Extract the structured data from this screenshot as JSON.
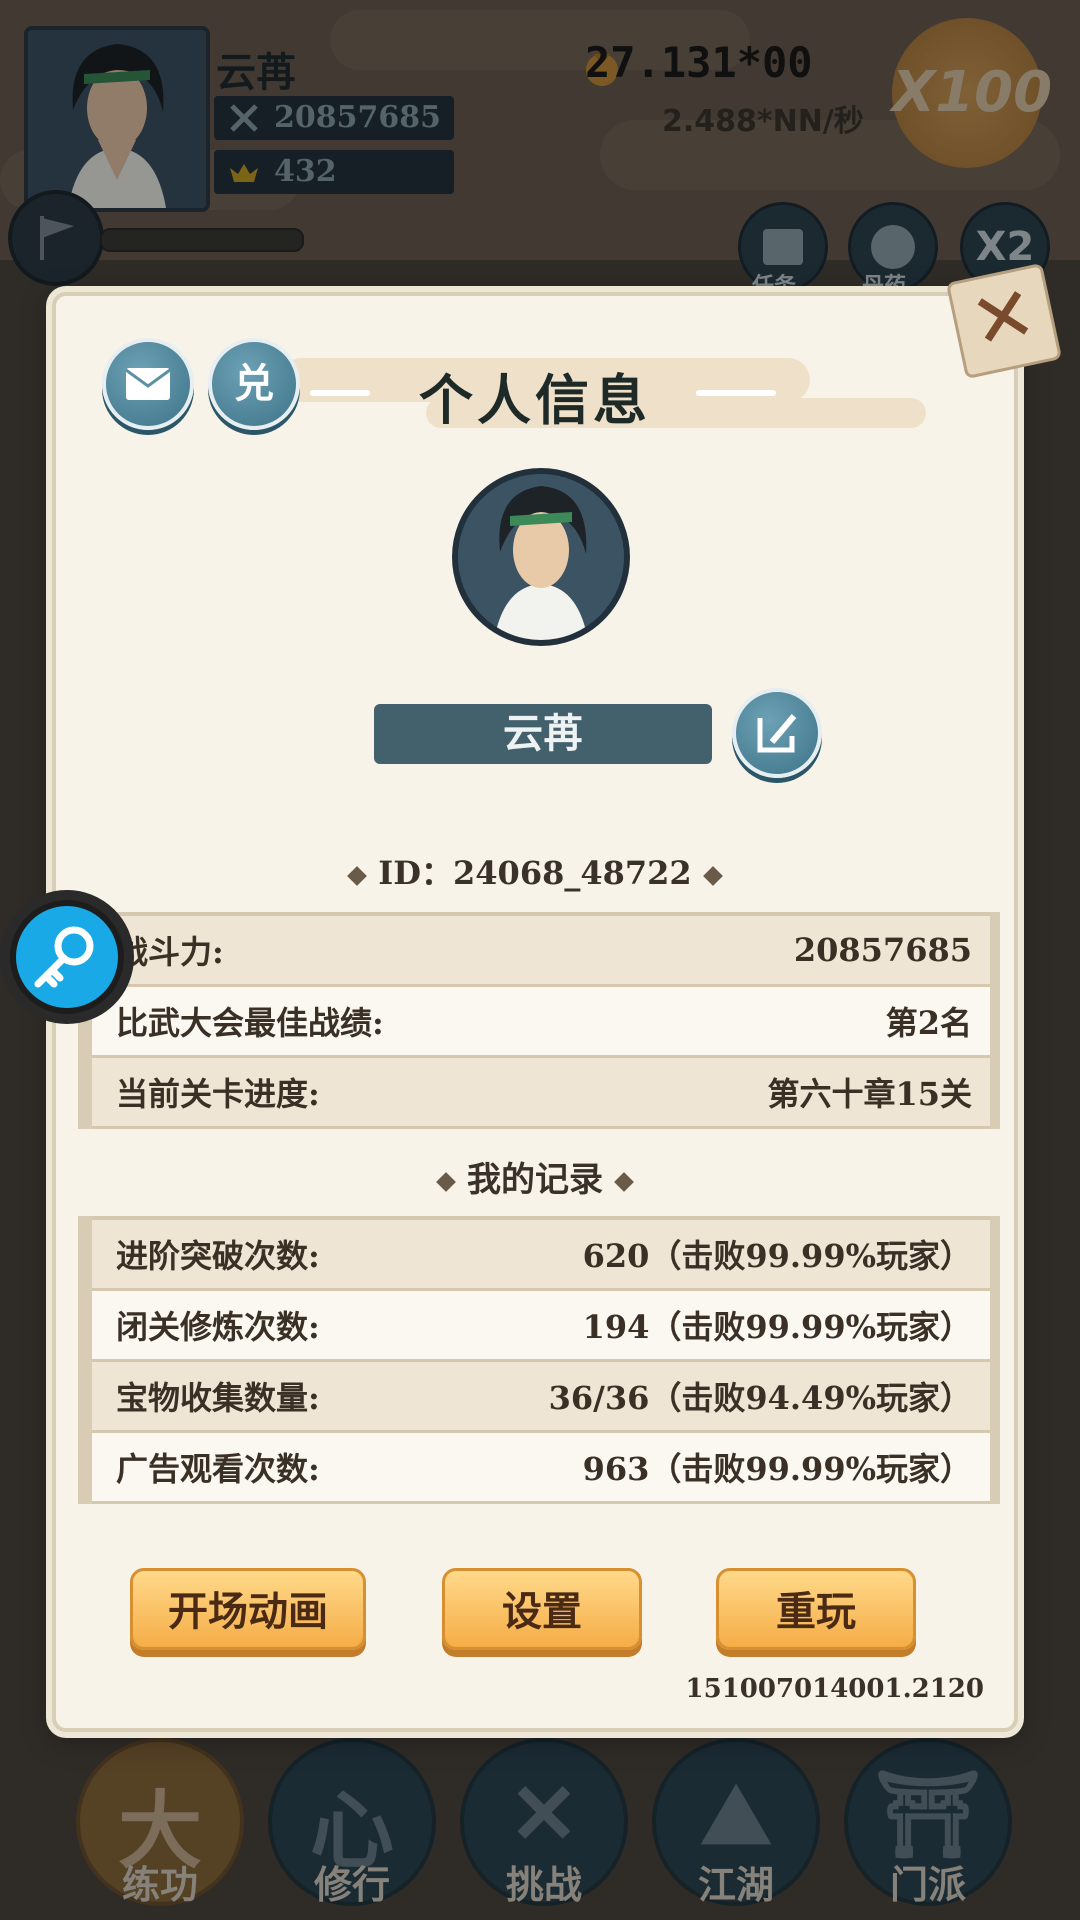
{
  "player": {
    "name": "云苒",
    "power": "20857685",
    "ingots": "432"
  },
  "currency": {
    "total": "27.131*00",
    "rate": "2.488*NN/秒",
    "multiplier": "X100"
  },
  "top_buttons": [
    {
      "label": "任务",
      "icon": "scroll-icon"
    },
    {
      "label": "丹药",
      "icon": "pill-icon"
    },
    {
      "label": "X2",
      "icon": "double-icon"
    }
  ],
  "dialog": {
    "title": "个人信息",
    "mail_icon": "mail-icon",
    "redeem_label": "兑",
    "close_label": "✕",
    "name": "云苒",
    "id_label": "ID：24068_48722",
    "stats": [
      {
        "label": "战斗力:",
        "value": "20857685"
      },
      {
        "label": "比武大会最佳战绩:",
        "value": "第2名"
      },
      {
        "label": "当前关卡进度:",
        "value": "第六十章15关"
      }
    ],
    "records_title": "我的记录",
    "records": [
      {
        "label": "进阶突破次数:",
        "value": "620（击败99.99%玩家）"
      },
      {
        "label": "闭关修炼次数:",
        "value": "194（击败99.99%玩家）"
      },
      {
        "label": "宝物收集数量:",
        "value": "36/36（击败94.49%玩家）"
      },
      {
        "label": "广告观看次数:",
        "value": "963（击败99.99%玩家）"
      }
    ],
    "buttons": {
      "intro": "开场动画",
      "settings": "设置",
      "replay": "重玩"
    },
    "version": "151007014001.2120"
  },
  "bottom_nav": [
    {
      "label": "练功",
      "glyph": "大",
      "active": true
    },
    {
      "label": "修行",
      "glyph": "心",
      "active": false
    },
    {
      "label": "挑战",
      "glyph": "✕",
      "active": false
    },
    {
      "label": "江湖",
      "glyph": "⛰",
      "active": false
    },
    {
      "label": "门派",
      "glyph": "⛩",
      "active": false
    }
  ],
  "colors": {
    "dialog_bg": "#f8f3e9",
    "accent_blue": "#43606d",
    "button_orange": "#f5ad47",
    "floating_key": "#19a9e6"
  }
}
